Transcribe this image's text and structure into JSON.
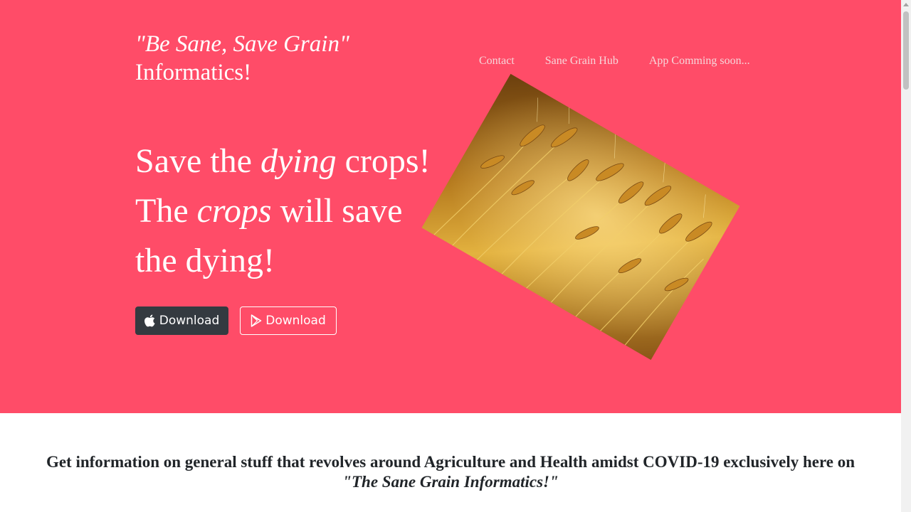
{
  "brand": {
    "tagline": "\"Be Sane, Save Grain\"",
    "name": "Informatics!"
  },
  "nav": {
    "items": [
      {
        "label": "Contact"
      },
      {
        "label": "Sane Grain Hub"
      },
      {
        "label": "App Comming soon..."
      }
    ]
  },
  "hero": {
    "line1_start": "Save the ",
    "line1_em": "dying",
    "line1_end": " crops!",
    "line2_start": "The ",
    "line2_em": "crops",
    "line2_end": " will save",
    "line3": "the dying!",
    "image_alt": "wheat field"
  },
  "buttons": {
    "apple_download": "Download",
    "play_download": "Download"
  },
  "info": {
    "text": "Get information on general stuff that revolves around Agriculture and Health amidst COVID-19 exclusively here on",
    "emphasis": "\"The Sane Grain Informatics!\""
  },
  "colors": {
    "hero_bg": "#ff4c68",
    "dark_button": "#343a40",
    "nav_link": "#f6d6da",
    "body_text": "#212529"
  },
  "icons": {
    "apple": "apple-icon",
    "play": "google-play-icon"
  }
}
